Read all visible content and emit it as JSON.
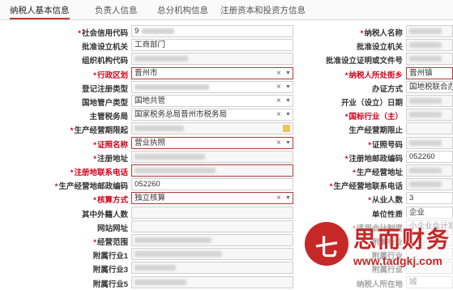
{
  "tabs": [
    "纳税人基本信息",
    "负责人信息",
    "总分机构信息",
    "注册资本和投资方信息"
  ],
  "left": [
    {
      "label": "社会信用代码",
      "value": "9",
      "req": true,
      "blur": true
    },
    {
      "label": "批准设立机关",
      "value": "工商部门"
    },
    {
      "label": "组织机构代码",
      "value": "",
      "blur": true
    },
    {
      "label": "行政区划",
      "value": "晋州市",
      "req": true,
      "select": true
    },
    {
      "label": "登记注册类型",
      "value": "",
      "blur": true,
      "select": true
    },
    {
      "label": "国地管户类型",
      "value": "国地共管",
      "select": true
    },
    {
      "label": "主管税务局",
      "value": "国家税务总局晋州市税务局",
      "select": true
    },
    {
      "label": "生产经营期限起",
      "value": "",
      "req": true,
      "blur": true
    },
    {
      "label": "证照名称",
      "value": "营业执照",
      "req": true,
      "select": true
    },
    {
      "label": "注册地址",
      "value": "",
      "req": true,
      "blur": true
    },
    {
      "label": "注册地联系电话",
      "value": "",
      "req": true,
      "blur": true
    },
    {
      "label": "生产经营地邮政编码",
      "value": "052260",
      "req": true
    },
    {
      "label": "核算方式",
      "value": "独立核算",
      "req": true,
      "select": true
    },
    {
      "label": "其中外籍人数",
      "value": ""
    },
    {
      "label": "网站网址",
      "value": ""
    },
    {
      "label": "经营范围",
      "value": "",
      "req": true,
      "blur": true
    },
    {
      "label": "附属行业1",
      "value": "",
      "blur": true
    },
    {
      "label": "附属行业3",
      "value": "",
      "blur": true
    },
    {
      "label": "附属行业5",
      "value": "",
      "blur": true
    }
  ],
  "right": [
    {
      "label": "纳税人名称",
      "value": "",
      "req": true,
      "blur": true
    },
    {
      "label": "批准设立机关",
      "value": "",
      "blur": true
    },
    {
      "label": "批准设立证明或文件号",
      "value": "",
      "blur": true
    },
    {
      "label": "纳税人所处街乡",
      "value": "晋州镇",
      "req": true
    },
    {
      "label": "办证方式",
      "value": "国地税联合办",
      "req": false
    },
    {
      "label": "开业（设立）日期",
      "value": "",
      "blur": true
    },
    {
      "label": "国标行业（主）",
      "value": "",
      "req": true,
      "blur": true
    },
    {
      "label": "生产经营期限止",
      "value": ""
    },
    {
      "label": "证照号码",
      "value": "",
      "req": true,
      "blur": true
    },
    {
      "label": "注册地邮政编码",
      "value": "052260",
      "req": true
    },
    {
      "label": "生产经营地址",
      "value": "",
      "req": true,
      "blur": true
    },
    {
      "label": "生产经营地联系电话",
      "value": "",
      "req": true,
      "blur": true
    },
    {
      "label": "从业人数",
      "value": "3",
      "req": true
    },
    {
      "label": "单位性质",
      "value": "企业"
    },
    {
      "label": "适用会计制度",
      "value": "小企业会计准则",
      "req": true
    },
    {
      "label": "附属行业",
      "value": ""
    },
    {
      "label": "附属行业",
      "value": ""
    },
    {
      "label": "附属行业",
      "value": ""
    },
    {
      "label": "纳税人所在地",
      "value": "城"
    }
  ],
  "watermark": {
    "logo": "七",
    "name": "思而财务",
    "url": "www.tadgkj.com"
  }
}
